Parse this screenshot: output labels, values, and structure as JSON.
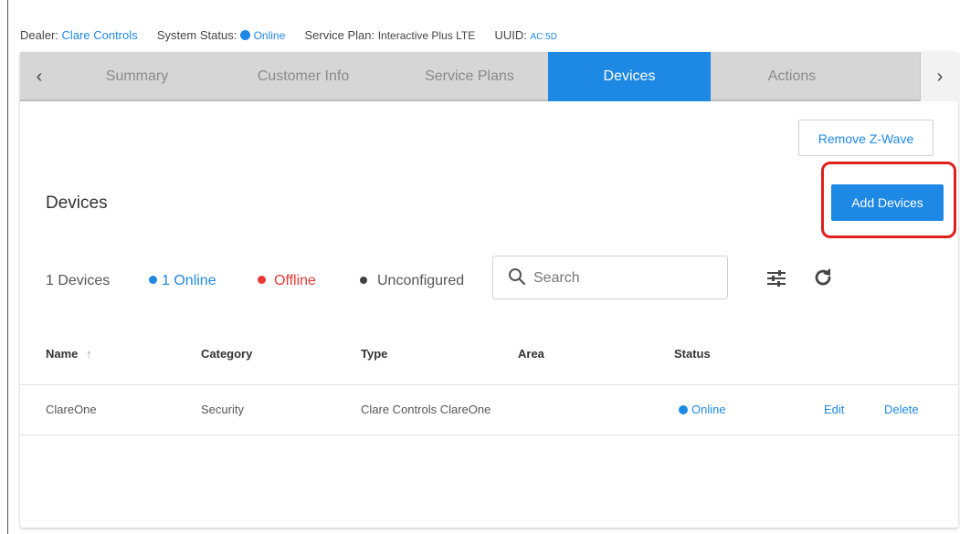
{
  "topbar": {
    "dealer_label": "Dealer:",
    "dealer_value": "Clare Controls",
    "status_label": "System Status:",
    "status_value": "Online",
    "plan_label": "Service Plan:",
    "plan_value": "Interactive Plus LTE",
    "uuid_label": "UUID:",
    "uuid_value": "AC:5D"
  },
  "tabs": [
    "Summary",
    "Customer Info",
    "Service Plans",
    "Devices",
    "Actions"
  ],
  "active_tab": "Devices",
  "arrows": {
    "left": "‹",
    "right": "›"
  },
  "buttons": {
    "remove_zwave": "Remove Z-Wave",
    "add_devices": "Add Devices"
  },
  "section_title": "Devices",
  "summary": {
    "total": "1 Devices",
    "online": "1 Online",
    "offline": "Offline",
    "unconfigured": "Unconfigured"
  },
  "search": {
    "placeholder": "Search"
  },
  "icons": {
    "search": "search-icon",
    "filter": "filter-sliders-icon",
    "refresh": "refresh-icon",
    "sort": "arrow-up-icon"
  },
  "table": {
    "headers": {
      "name": "Name",
      "sort_arrow": "↑",
      "category": "Category",
      "type": "Type",
      "area": "Area",
      "status": "Status"
    },
    "rows": [
      {
        "name": "ClareOne",
        "category": "Security",
        "type": "Clare Controls ClareOne",
        "area": "",
        "status": "Online",
        "edit": "Edit",
        "delete": "Delete"
      }
    ]
  },
  "colors": {
    "accent": "#1e88e5",
    "online": "#1e88e5",
    "offline": "#e53935",
    "unconfigured": "#424242",
    "highlight": "#e0201c"
  }
}
